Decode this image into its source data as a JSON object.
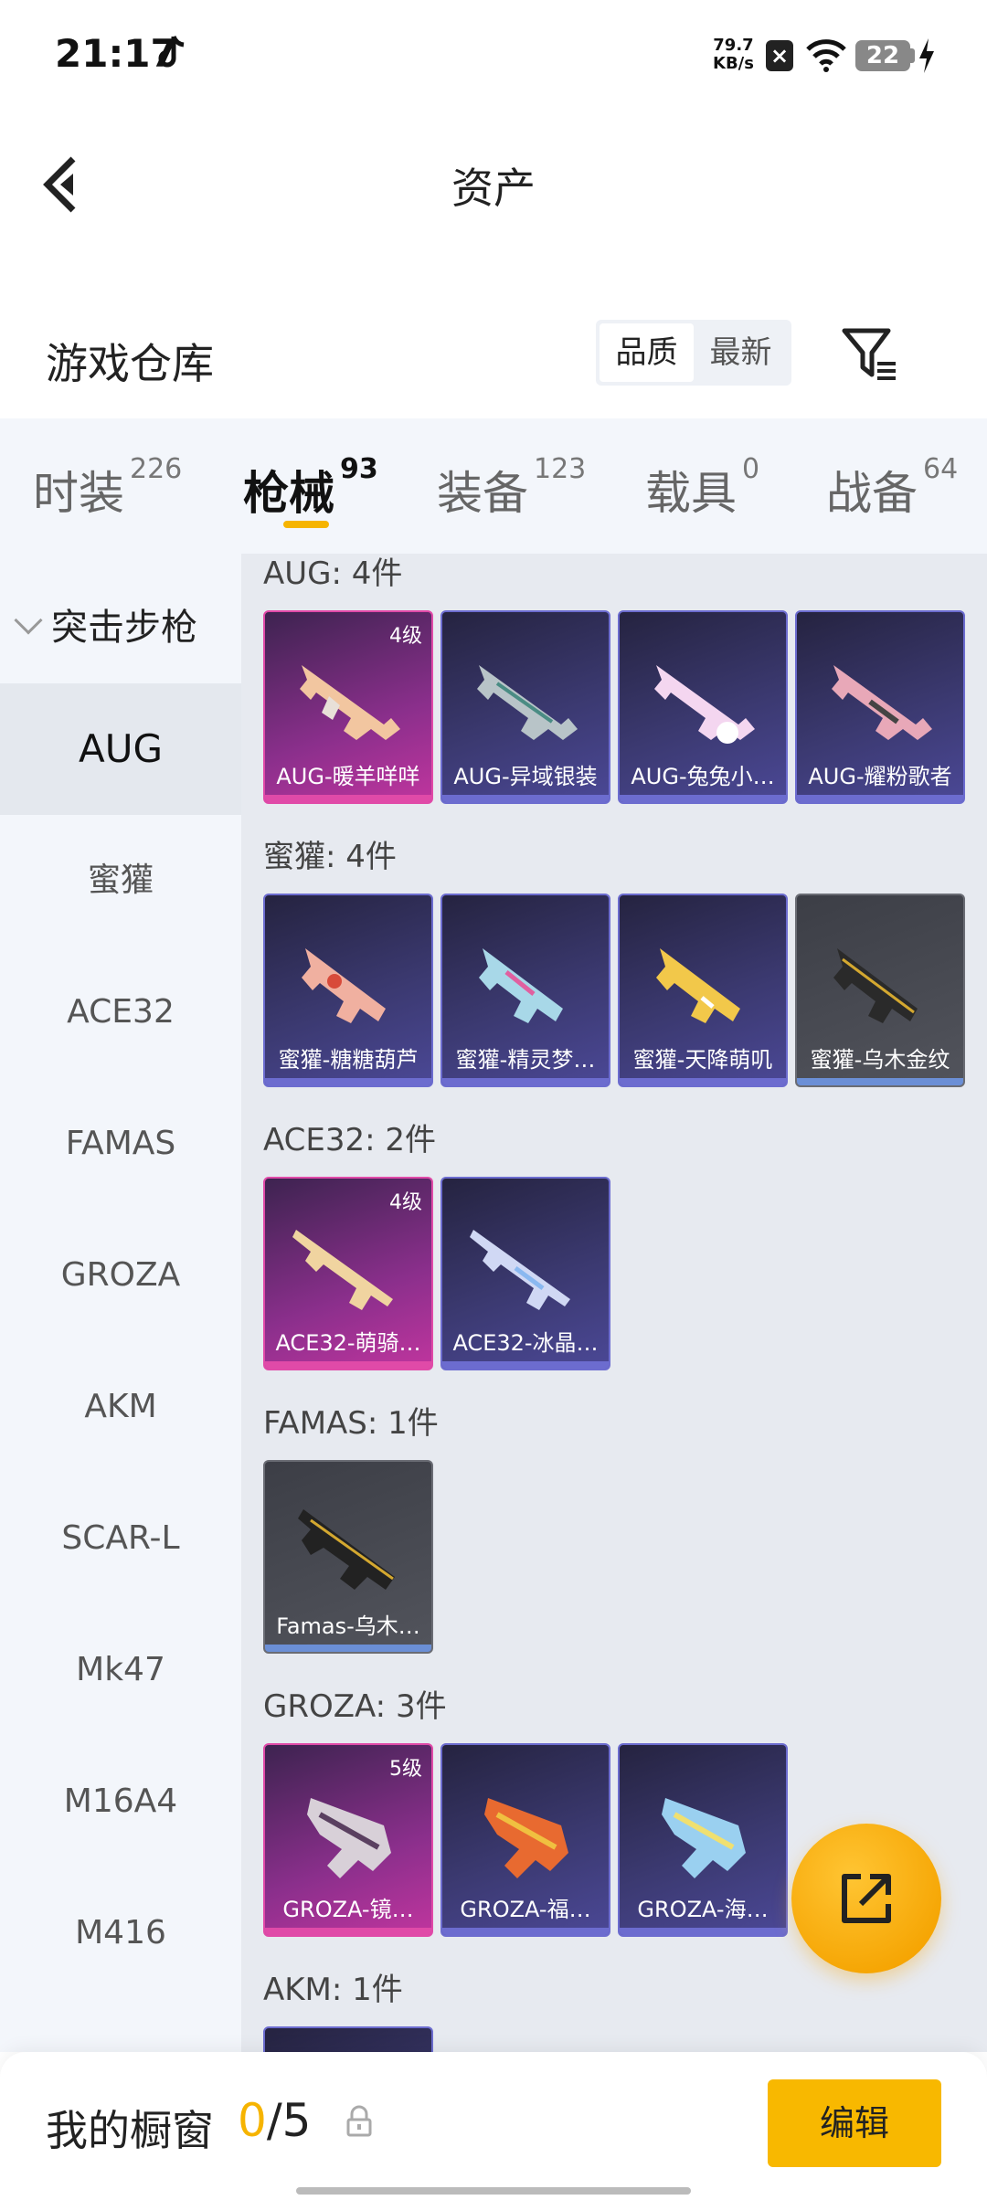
{
  "status_bar": {
    "time": "21:17",
    "net_speed_value": "79.7",
    "net_speed_unit": "KB/s",
    "battery": "22"
  },
  "header": {
    "title": "资产"
  },
  "warehouse": {
    "title": "游戏仓库",
    "sort_options": [
      "品质",
      "最新"
    ],
    "sort_selected": "品质"
  },
  "tabs": [
    {
      "label": "时装",
      "count": "226"
    },
    {
      "label": "枪械",
      "count": "93"
    },
    {
      "label": "装备",
      "count": "123"
    },
    {
      "label": "载具",
      "count": "0"
    },
    {
      "label": "战备",
      "count": "64"
    }
  ],
  "sidebar": {
    "category": "突击步枪",
    "items": [
      "AUG",
      "蜜獾",
      "ACE32",
      "FAMAS",
      "GROZA",
      "AKM",
      "SCAR-L",
      "Mk47",
      "M16A4",
      "M416"
    ],
    "selected": "AUG"
  },
  "groups": [
    {
      "label": "AUG: 4件",
      "items": [
        {
          "name": "AUG-暖羊咩咩",
          "level": "4级",
          "rarity": "pink"
        },
        {
          "name": "AUG-异域银装",
          "level": "",
          "rarity": "purple"
        },
        {
          "name": "AUG-兔兔小…",
          "level": "",
          "rarity": "purple"
        },
        {
          "name": "AUG-耀粉歌者",
          "level": "",
          "rarity": "purple"
        }
      ]
    },
    {
      "label": "蜜獾: 4件",
      "items": [
        {
          "name": "蜜獾-糖糖葫芦",
          "level": "",
          "rarity": "purple"
        },
        {
          "name": "蜜獾-精灵梦…",
          "level": "",
          "rarity": "purple"
        },
        {
          "name": "蜜獾-天降萌叽",
          "level": "",
          "rarity": "purple"
        },
        {
          "name": "蜜獾-乌木金纹",
          "level": "",
          "rarity": "gray"
        }
      ]
    },
    {
      "label": "ACE32: 2件",
      "items": [
        {
          "name": "ACE32-萌骑…",
          "level": "4级",
          "rarity": "pink"
        },
        {
          "name": "ACE32-冰晶…",
          "level": "",
          "rarity": "purple"
        }
      ]
    },
    {
      "label": "FAMAS: 1件",
      "items": [
        {
          "name": "Famas-乌木…",
          "level": "",
          "rarity": "gray"
        }
      ]
    },
    {
      "label": "GROZA: 3件",
      "items": [
        {
          "name": "GROZA-镜…",
          "level": "5级",
          "rarity": "pink"
        },
        {
          "name": "GROZA-福…",
          "level": "",
          "rarity": "purple"
        },
        {
          "name": "GROZA-海…",
          "level": "",
          "rarity": "purple"
        }
      ]
    },
    {
      "label": "AKM: 1件",
      "items": []
    }
  ],
  "showcase": {
    "title": "我的橱窗",
    "current": "0",
    "separator": "/",
    "max": "5",
    "edit_label": "编辑"
  },
  "colors": {
    "accent": "#f6b400",
    "pink_rarity": "#e04aa8",
    "purple_rarity": "#6c6ccf",
    "gray_rarity": "#6b8fd6"
  }
}
